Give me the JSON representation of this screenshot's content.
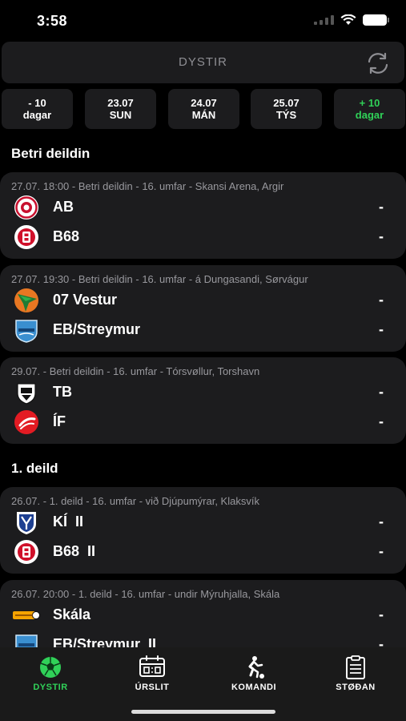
{
  "status": {
    "time": "3:58"
  },
  "header": {
    "title": "DYSTIR"
  },
  "dates": [
    {
      "line1": "- 10",
      "line2": "dagar",
      "color": "#ffffff"
    },
    {
      "line1": "23.07",
      "line2": "SUN",
      "color": "#ffffff"
    },
    {
      "line1": "24.07",
      "line2": "MÁN",
      "color": "#ffffff"
    },
    {
      "line1": "25.07",
      "line2": "TÝS",
      "color": "#ffffff"
    },
    {
      "line1": "+ 10",
      "line2": "dagar",
      "color": "#30d158"
    }
  ],
  "sections": [
    {
      "title": "Betri deildin",
      "matches": [
        {
          "meta": "27.07. 18:00 - Betri deildin - 16. umfar - Skansi Arena, Argir",
          "home": {
            "name": "AB",
            "score": "-",
            "logo": "ab-logo"
          },
          "away": {
            "name": "B68",
            "score": "-",
            "logo": "b68-logo"
          }
        },
        {
          "meta": "27.07. 19:30 - Betri deildin - 16. umfar - á Dungasandi, Sørvágur",
          "home": {
            "name": "07 Vestur",
            "score": "-",
            "logo": "07-vestur-logo"
          },
          "away": {
            "name": "EB/Streymur",
            "score": "-",
            "logo": "eb-streymur-logo"
          }
        },
        {
          "meta": "29.07. - Betri deildin - 16. umfar - Tórsvøllur, Torshavn",
          "home": {
            "name": "TB",
            "score": "-",
            "logo": "tb-logo"
          },
          "away": {
            "name": "ÍF",
            "score": "-",
            "logo": "if-logo"
          }
        }
      ]
    },
    {
      "title": "1. deild",
      "matches": [
        {
          "meta": "26.07. - 1. deild - 16. umfar - við Djúpumýrar, Klaksvík",
          "home": {
            "name": "KÍ  II",
            "score": "-",
            "logo": "ki-logo"
          },
          "away": {
            "name": "B68  II",
            "score": "-",
            "logo": "b68-logo"
          }
        },
        {
          "meta": "26.07. 20:00 - 1. deild - 16. umfar - undir Mýruhjalla, Skála",
          "home": {
            "name": "Skála",
            "score": "-",
            "logo": "skala-logo"
          },
          "away": {
            "name": "EB/Streymur  II",
            "score": "-",
            "logo": "eb-streymur-logo"
          }
        }
      ]
    }
  ],
  "tabs": [
    {
      "label": "DYSTIR",
      "icon": "soccer-ball-icon",
      "active": true
    },
    {
      "label": "ÚRSLIT",
      "icon": "scoreboard-icon",
      "active": false
    },
    {
      "label": "KOMANDI",
      "icon": "player-kick-icon",
      "active": false
    },
    {
      "label": "STØÐAN",
      "icon": "clipboard-icon",
      "active": false
    }
  ],
  "colors": {
    "accent": "#30d158",
    "card": "#1c1c1e",
    "meta": "#98989d"
  }
}
